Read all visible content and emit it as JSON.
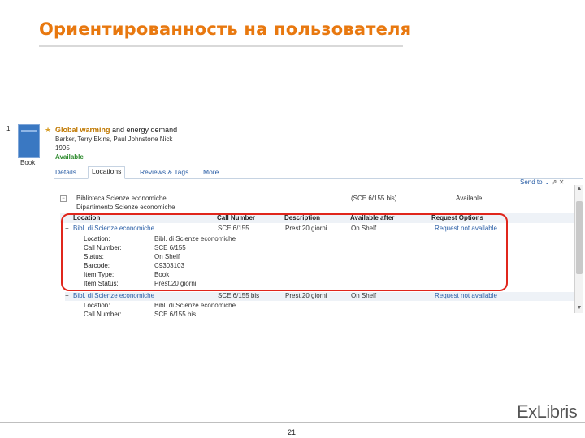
{
  "slide": {
    "title": "Ориентированность на пользователя",
    "page_number": "21",
    "logo": "ExLibris"
  },
  "record": {
    "index": "1",
    "title_highlight": "Global warming",
    "title_rest": " and energy demand",
    "authors": "Barker, Terry Ekins, Paul Johnstone Nick",
    "year": "1995",
    "status": "Available",
    "format": "Book"
  },
  "tabs": [
    {
      "label": "Details"
    },
    {
      "label": "Locations"
    },
    {
      "label": "Reviews & Tags"
    },
    {
      "label": "More"
    }
  ],
  "send_to": "Send to",
  "library": {
    "name": "Biblioteca Scienze economiche",
    "call_number": "(SCE 6/155 bis)",
    "status": "Available",
    "department": "Dipartimento Scienze economiche"
  },
  "table": {
    "headers": [
      "Location",
      "Call Number",
      "Description",
      "Available after",
      "Request Options"
    ],
    "rows": [
      {
        "location": "Bibl. di Scienze economiche",
        "call_number": "SCE 6/155",
        "description": "Prest.20 giorni",
        "available_after": "On Shelf",
        "request": "Request not available"
      },
      {
        "location": "Bibl. di Scienze economiche",
        "call_number": "SCE 6/155 bis",
        "description": "Prest.20 giorni",
        "available_after": "On Shelf",
        "request": "Request not available"
      }
    ],
    "details": [
      {
        "label": "Location:",
        "value": "Bibl. di Scienze economiche"
      },
      {
        "label": "Call Number:",
        "value": "SCE 6/155"
      },
      {
        "label": "Status:",
        "value": "On Shelf"
      },
      {
        "label": "Barcode:",
        "value": "C9303103"
      },
      {
        "label": "Item Type:",
        "value": "Book"
      },
      {
        "label": "Item Status:",
        "value": "Prest.20 giorni"
      }
    ],
    "partial_row": {
      "label": "Call Number:",
      "value": "SCE 6/155 bis"
    }
  },
  "colors": {
    "title": "#e8780f",
    "highlight": "#e0261c",
    "link": "#2a5ea6",
    "available": "#2c8a2c"
  }
}
